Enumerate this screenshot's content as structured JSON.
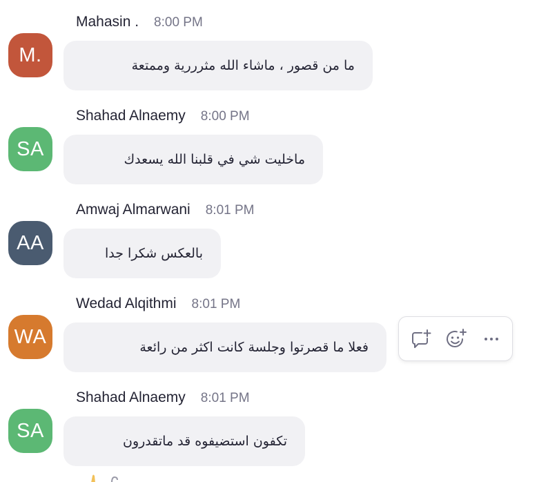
{
  "messages": [
    {
      "initials": "M.",
      "avatar_color": "#c2563b",
      "sender": "Mahasin .",
      "time": "8:00 PM",
      "text": "ما من قصور ، ماشاء الله مثرررية وممتعة"
    },
    {
      "initials": "SA",
      "avatar_color": "#5cb874",
      "sender": "Shahad Alnaemy",
      "time": "8:00 PM",
      "text": "ماخليت شي في قلبنا الله يسعدك"
    },
    {
      "initials": "AA",
      "avatar_color": "#4a5b70",
      "sender": "Amwaj Almarwani",
      "time": "8:01 PM",
      "text": "بالعكس شكرا جدا"
    },
    {
      "initials": "WA",
      "avatar_color": "#d67a2e",
      "sender": "Wedad Alqithmi",
      "time": "8:01 PM",
      "text": "فعلا ما قصرتوا وجلسة كانت اكثر من رائعة"
    },
    {
      "initials": "SA",
      "avatar_color": "#5cb874",
      "sender": "Shahad Alnaemy",
      "time": "8:01 PM",
      "text": "تكفون استضيفوه قد ماتقدرون"
    }
  ],
  "hover_toolbar": {
    "icons": [
      "reply-in-thread-icon",
      "add-reaction-icon",
      "more-options-icon"
    ],
    "icon_color": "#6e6e82"
  }
}
